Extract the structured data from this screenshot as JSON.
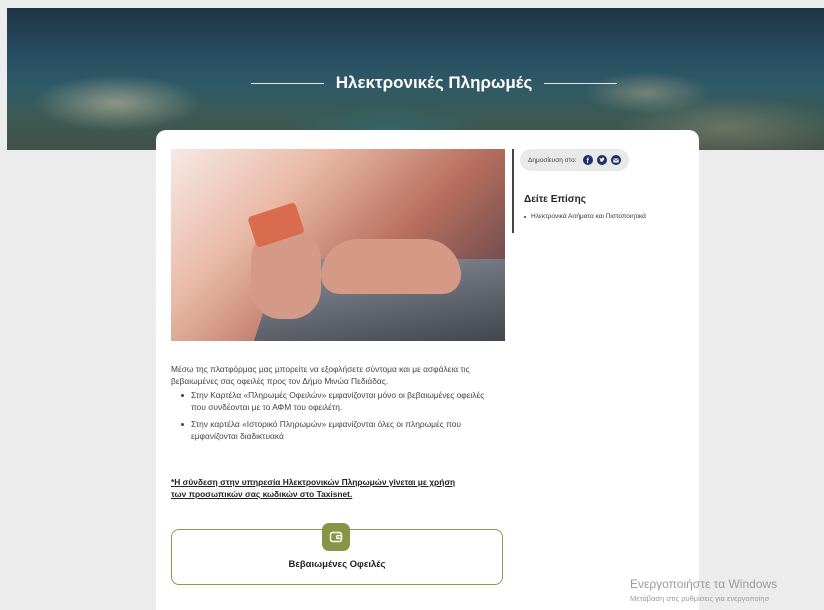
{
  "hero": {
    "title": "Ηλεκτρονικές Πληρωμές"
  },
  "main": {
    "intro": "Μέσω της πλατφόρμας μας μπορείτε να εξοφλήσετε σύντομα και με ασφάλεια τις βεβαιωμένες σας οφειλές προς τον Δήμο Μινώα Πεδιάδας.",
    "bullets": [
      "Στην Καρτέλα «Πληρωμές Οφειλών» εμφανίζονται μόνο οι βεβαιωμένες οφειλές που συνδέονται με το ΑΦΜ του οφειλέτη.",
      "Στην καρτέλα «Ιστορικό Πληρωμών» εμφανίζονται όλες οι πληρωμές που εμφανίζονται διαδικτυακά"
    ],
    "taxis_note": "*Η σύνδεση στην υπηρεσία Ηλεκτρονικών Πληρωμών γίνεται με χρήση των προσωπικών σας κωδικών στο Taxisnet.",
    "debts_button": "Βεβαιωμένες Οφειλές"
  },
  "sidebar": {
    "share_label": "Δημοσίευση στο:",
    "share_icons": [
      "facebook-icon",
      "twitter-icon",
      "email-icon"
    ],
    "see_also_title": "Δείτε Επίσης",
    "see_also_items": [
      "Ηλεκτρονικά Αιτήματα και Πιστοποιητικά"
    ]
  },
  "watermark": {
    "title": "Ενεργοποιήστε τα Windows",
    "subtitle": "Μετάβαση στις ρυθμίσεις για ενεργοποίησ"
  },
  "colors": {
    "accent_olive": "#889546",
    "social_navy": "#1f2f6b"
  }
}
